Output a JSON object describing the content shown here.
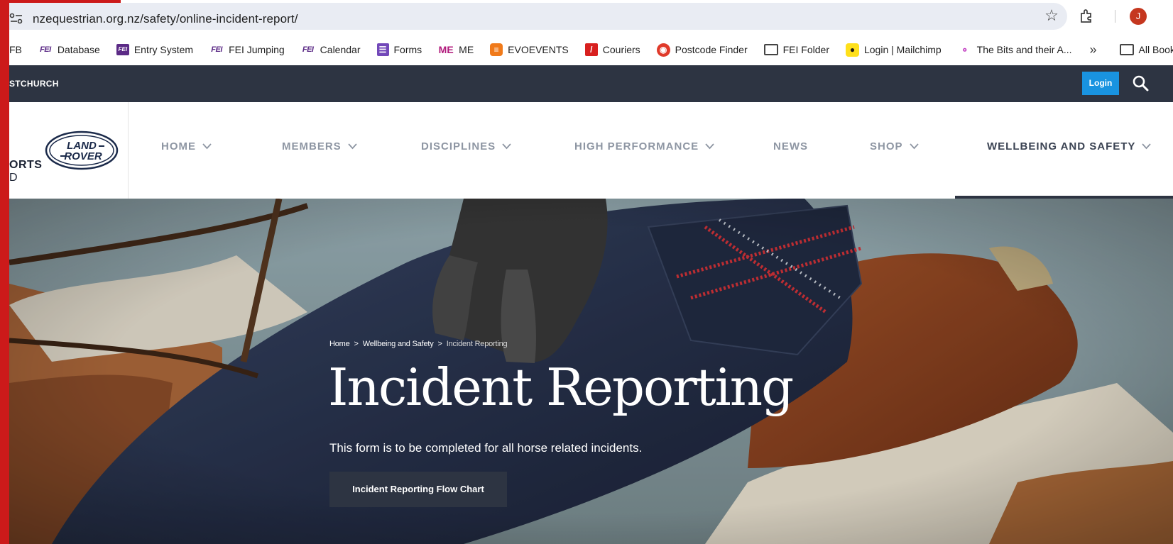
{
  "browser": {
    "url": "nzequestrian.org.nz/safety/online-incident-report/",
    "avatar_letter": "J",
    "icons": [
      "site-info-icon",
      "star-icon",
      "extensions-icon"
    ],
    "bookmarks": [
      {
        "label": "FB",
        "icon": "fb-icon"
      },
      {
        "label": "Database",
        "icon": "fei-icon"
      },
      {
        "label": "Entry System",
        "icon": "fei-box-icon"
      },
      {
        "label": "FEI Jumping",
        "icon": "fei-icon"
      },
      {
        "label": "Calendar",
        "icon": "fei-icon"
      },
      {
        "label": "Forms",
        "icon": "forms-icon"
      },
      {
        "label": "ME",
        "icon": "me-icon"
      },
      {
        "label": "EVOEVENTS",
        "icon": "evo-icon"
      },
      {
        "label": "Couriers",
        "icon": "couriers-icon"
      },
      {
        "label": "Postcode Finder",
        "icon": "postcode-icon"
      },
      {
        "label": "FEI Folder",
        "icon": "folder-icon"
      },
      {
        "label": "Login | Mailchimp",
        "icon": "mailchimp-icon"
      },
      {
        "label": "The Bits and their A...",
        "icon": "bits-icon"
      }
    ],
    "more_label": "»",
    "all_bookmarks_label": "All Bookma"
  },
  "site": {
    "topbar_text": "STCHURCH",
    "login_label": "Login",
    "logo_text_1": "ORTS",
    "logo_text_2": "D",
    "badge_line_1": "LAND",
    "badge_line_2": "ROVER",
    "nav": [
      {
        "label": "HOME",
        "dropdown": true
      },
      {
        "label": "MEMBERS",
        "dropdown": true
      },
      {
        "label": "DISCIPLINES",
        "dropdown": true
      },
      {
        "label": "HIGH PERFORMANCE",
        "dropdown": true
      },
      {
        "label": "NEWS",
        "dropdown": false
      },
      {
        "label": "SHOP",
        "dropdown": true
      },
      {
        "label": "WELLBEING AND SAFETY",
        "dropdown": true,
        "active": true
      }
    ]
  },
  "hero": {
    "breadcrumb": [
      "Home",
      "Wellbeing and Safety",
      "Incident Reporting"
    ],
    "breadcrumb_separator": ">",
    "title": "Incident Reporting",
    "subtitle": "This form is to be completed for all horse related incidents.",
    "button_label": "Incident Reporting Flow Chart"
  },
  "colors": {
    "header_dark": "#2d3442",
    "login_blue": "#1993e0",
    "nav_grey": "#8e96a3",
    "left_strip_red": "#cc1a1a"
  }
}
